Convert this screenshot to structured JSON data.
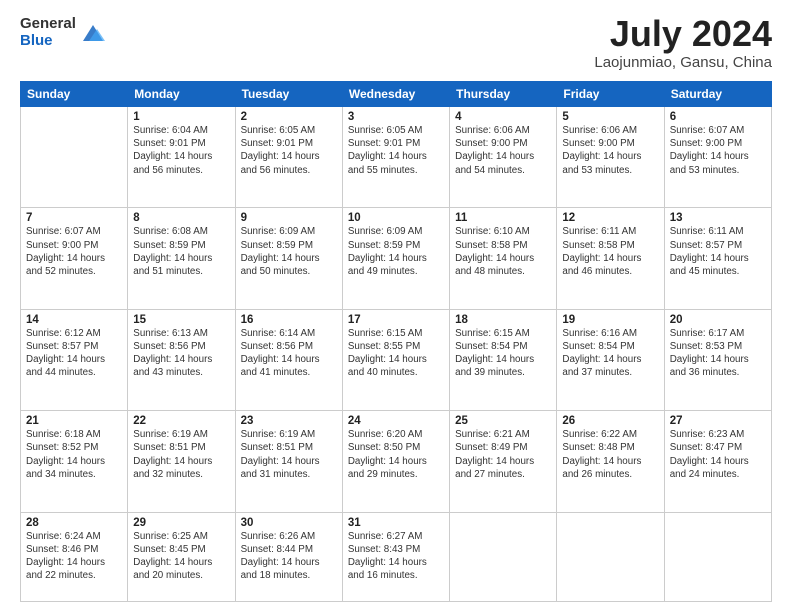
{
  "header": {
    "logo_general": "General",
    "logo_blue": "Blue",
    "month_year": "July 2024",
    "location": "Laojunmiao, Gansu, China"
  },
  "weekdays": [
    "Sunday",
    "Monday",
    "Tuesday",
    "Wednesday",
    "Thursday",
    "Friday",
    "Saturday"
  ],
  "weeks": [
    [
      {
        "day": "",
        "info": ""
      },
      {
        "day": "1",
        "info": "Sunrise: 6:04 AM\nSunset: 9:01 PM\nDaylight: 14 hours\nand 56 minutes."
      },
      {
        "day": "2",
        "info": "Sunrise: 6:05 AM\nSunset: 9:01 PM\nDaylight: 14 hours\nand 56 minutes."
      },
      {
        "day": "3",
        "info": "Sunrise: 6:05 AM\nSunset: 9:01 PM\nDaylight: 14 hours\nand 55 minutes."
      },
      {
        "day": "4",
        "info": "Sunrise: 6:06 AM\nSunset: 9:00 PM\nDaylight: 14 hours\nand 54 minutes."
      },
      {
        "day": "5",
        "info": "Sunrise: 6:06 AM\nSunset: 9:00 PM\nDaylight: 14 hours\nand 53 minutes."
      },
      {
        "day": "6",
        "info": "Sunrise: 6:07 AM\nSunset: 9:00 PM\nDaylight: 14 hours\nand 53 minutes."
      }
    ],
    [
      {
        "day": "7",
        "info": "Sunrise: 6:07 AM\nSunset: 9:00 PM\nDaylight: 14 hours\nand 52 minutes."
      },
      {
        "day": "8",
        "info": "Sunrise: 6:08 AM\nSunset: 8:59 PM\nDaylight: 14 hours\nand 51 minutes."
      },
      {
        "day": "9",
        "info": "Sunrise: 6:09 AM\nSunset: 8:59 PM\nDaylight: 14 hours\nand 50 minutes."
      },
      {
        "day": "10",
        "info": "Sunrise: 6:09 AM\nSunset: 8:59 PM\nDaylight: 14 hours\nand 49 minutes."
      },
      {
        "day": "11",
        "info": "Sunrise: 6:10 AM\nSunset: 8:58 PM\nDaylight: 14 hours\nand 48 minutes."
      },
      {
        "day": "12",
        "info": "Sunrise: 6:11 AM\nSunset: 8:58 PM\nDaylight: 14 hours\nand 46 minutes."
      },
      {
        "day": "13",
        "info": "Sunrise: 6:11 AM\nSunset: 8:57 PM\nDaylight: 14 hours\nand 45 minutes."
      }
    ],
    [
      {
        "day": "14",
        "info": "Sunrise: 6:12 AM\nSunset: 8:57 PM\nDaylight: 14 hours\nand 44 minutes."
      },
      {
        "day": "15",
        "info": "Sunrise: 6:13 AM\nSunset: 8:56 PM\nDaylight: 14 hours\nand 43 minutes."
      },
      {
        "day": "16",
        "info": "Sunrise: 6:14 AM\nSunset: 8:56 PM\nDaylight: 14 hours\nand 41 minutes."
      },
      {
        "day": "17",
        "info": "Sunrise: 6:15 AM\nSunset: 8:55 PM\nDaylight: 14 hours\nand 40 minutes."
      },
      {
        "day": "18",
        "info": "Sunrise: 6:15 AM\nSunset: 8:54 PM\nDaylight: 14 hours\nand 39 minutes."
      },
      {
        "day": "19",
        "info": "Sunrise: 6:16 AM\nSunset: 8:54 PM\nDaylight: 14 hours\nand 37 minutes."
      },
      {
        "day": "20",
        "info": "Sunrise: 6:17 AM\nSunset: 8:53 PM\nDaylight: 14 hours\nand 36 minutes."
      }
    ],
    [
      {
        "day": "21",
        "info": "Sunrise: 6:18 AM\nSunset: 8:52 PM\nDaylight: 14 hours\nand 34 minutes."
      },
      {
        "day": "22",
        "info": "Sunrise: 6:19 AM\nSunset: 8:51 PM\nDaylight: 14 hours\nand 32 minutes."
      },
      {
        "day": "23",
        "info": "Sunrise: 6:19 AM\nSunset: 8:51 PM\nDaylight: 14 hours\nand 31 minutes."
      },
      {
        "day": "24",
        "info": "Sunrise: 6:20 AM\nSunset: 8:50 PM\nDaylight: 14 hours\nand 29 minutes."
      },
      {
        "day": "25",
        "info": "Sunrise: 6:21 AM\nSunset: 8:49 PM\nDaylight: 14 hours\nand 27 minutes."
      },
      {
        "day": "26",
        "info": "Sunrise: 6:22 AM\nSunset: 8:48 PM\nDaylight: 14 hours\nand 26 minutes."
      },
      {
        "day": "27",
        "info": "Sunrise: 6:23 AM\nSunset: 8:47 PM\nDaylight: 14 hours\nand 24 minutes."
      }
    ],
    [
      {
        "day": "28",
        "info": "Sunrise: 6:24 AM\nSunset: 8:46 PM\nDaylight: 14 hours\nand 22 minutes."
      },
      {
        "day": "29",
        "info": "Sunrise: 6:25 AM\nSunset: 8:45 PM\nDaylight: 14 hours\nand 20 minutes."
      },
      {
        "day": "30",
        "info": "Sunrise: 6:26 AM\nSunset: 8:44 PM\nDaylight: 14 hours\nand 18 minutes."
      },
      {
        "day": "31",
        "info": "Sunrise: 6:27 AM\nSunset: 8:43 PM\nDaylight: 14 hours\nand 16 minutes."
      },
      {
        "day": "",
        "info": ""
      },
      {
        "day": "",
        "info": ""
      },
      {
        "day": "",
        "info": ""
      }
    ]
  ]
}
